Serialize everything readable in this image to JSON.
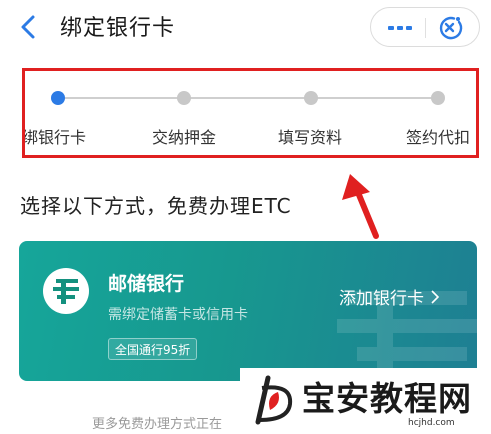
{
  "header": {
    "title": "绑定银行卡",
    "back_icon": "back-arrow-icon",
    "more_icon": "more-dots-icon",
    "close_icon": "miniapp-close-icon"
  },
  "stepper": {
    "steps": [
      {
        "label": "绑银行卡",
        "active": true
      },
      {
        "label": "交纳押金",
        "active": false
      },
      {
        "label": "填写资料",
        "active": false
      },
      {
        "label": "签约代扣",
        "active": false
      }
    ]
  },
  "section_heading": "选择以下方式，免费办理ETC",
  "bank_card": {
    "name": "邮储银行",
    "description": "需绑定储蓄卡或信用卡",
    "badge": "全国通行95折",
    "action_label": "添加银行卡",
    "logo_icon": "postal-bank-logo-icon"
  },
  "more_methods_text": "更多免费办理方式正在",
  "watermark": {
    "title": "宝安教程网",
    "url": "hcjhd.com"
  },
  "colors": {
    "accent": "#2c7be5",
    "highlight_box": "#e02020",
    "card_start": "#16a69a",
    "card_end": "#1e7f93"
  }
}
